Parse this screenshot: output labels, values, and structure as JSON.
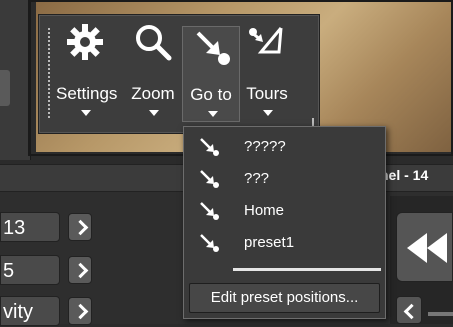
{
  "toolbar": {
    "buttons": [
      {
        "label": "Settings",
        "icon": "gear-icon"
      },
      {
        "label": "Zoom",
        "icon": "magnifier-icon"
      },
      {
        "label": "Go to",
        "icon": "goto-arrow-icon"
      },
      {
        "label": "Tours",
        "icon": "tours-path-icon"
      }
    ]
  },
  "header": {
    "channel_title": "nel - 14"
  },
  "left_controls": {
    "fields": [
      "13",
      "5",
      "vity"
    ]
  },
  "goto_menu": {
    "items": [
      {
        "label": "?????",
        "icon": "preset-arrow-icon"
      },
      {
        "label": "???",
        "icon": "preset-arrow-icon"
      },
      {
        "label": "Home",
        "icon": "preset-arrow-icon"
      },
      {
        "label": "preset1",
        "icon": "preset-arrow-icon"
      }
    ],
    "edit_label": "Edit preset positions..."
  },
  "colors": {
    "panel": "#3d3d3d",
    "menu": "#3a3a3a",
    "text": "#ffffff"
  }
}
